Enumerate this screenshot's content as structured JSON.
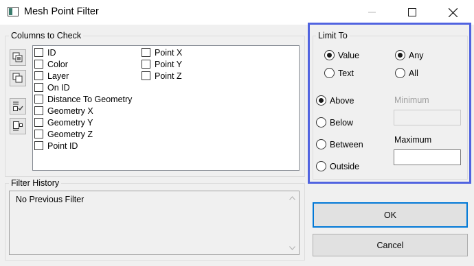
{
  "window": {
    "title": "Mesh Point Filter"
  },
  "columns_group": {
    "label": "Columns to Check",
    "items_col1": [
      "ID",
      "Color",
      "Layer",
      "On ID",
      "Distance To Geometry",
      "Geometry X",
      "Geometry Y",
      "Geometry Z",
      "Point ID"
    ],
    "items_col2": [
      "Point X",
      "Point Y",
      "Point Z"
    ]
  },
  "filter_history": {
    "label": "Filter History",
    "text": "No Previous Filter"
  },
  "limit_to": {
    "label": "Limit To",
    "value_label": "Value",
    "text_label": "Text",
    "any_label": "Any",
    "all_label": "All",
    "above_label": "Above",
    "below_label": "Below",
    "between_label": "Between",
    "outside_label": "Outside",
    "minimum_label": "Minimum",
    "maximum_label": "Maximum",
    "minimum_value": "",
    "maximum_value": ""
  },
  "buttons": {
    "ok": "OK",
    "cancel": "Cancel"
  },
  "colors": {
    "highlight": "#5063e0",
    "default_button_border": "#0078d7"
  }
}
